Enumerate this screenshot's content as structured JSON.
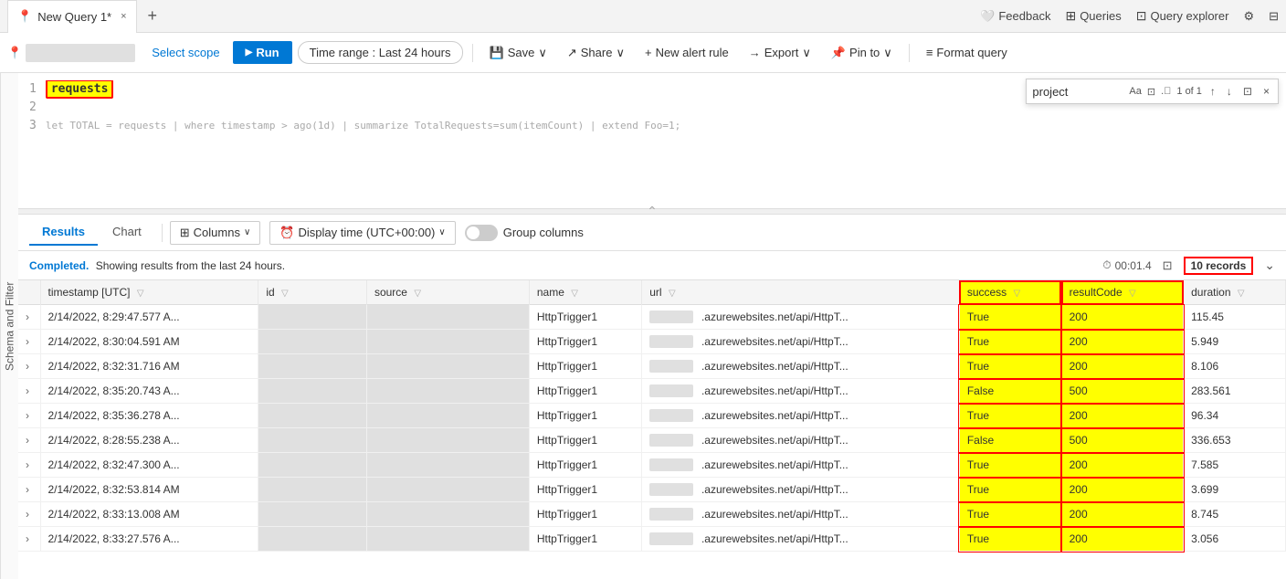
{
  "app": {
    "title": "New Query 1*",
    "tab_close": "×",
    "tab_add": "+",
    "top_actions": [
      {
        "id": "feedback",
        "icon": "❤",
        "label": "Feedback"
      },
      {
        "id": "queries",
        "icon": "⊞",
        "label": "Queries"
      },
      {
        "id": "query-explorer",
        "icon": "⊡",
        "label": "Query explorer"
      },
      {
        "id": "settings",
        "icon": "⚙",
        "label": ""
      },
      {
        "id": "layout",
        "icon": "⊟",
        "label": ""
      }
    ]
  },
  "toolbar": {
    "scope_placeholder": "",
    "select_scope": "Select scope",
    "run_label": "Run",
    "time_range_label": "Time range :  Last 24 hours",
    "save_label": "Save",
    "share_label": "Share",
    "new_alert_label": "New alert rule",
    "export_label": "Export",
    "pin_label": "Pin to",
    "format_label": "Format query"
  },
  "editor": {
    "search_placeholder": "project",
    "search_count": "1 of 1",
    "lines": [
      {
        "num": 1,
        "code": "requests",
        "highlight": true
      },
      {
        "num": 2,
        "code": ""
      },
      {
        "num": 3,
        "code": "let TOTAL = requests | where timestamp > ago(1d) | summarize TotalRequests=sum(itemCount) | extend Foo=1;",
        "dim": true
      }
    ]
  },
  "results_tabs": {
    "results_label": "Results",
    "chart_label": "Chart",
    "columns_label": "Columns",
    "display_time_label": "Display time (UTC+00:00)",
    "group_columns_label": "Group columns"
  },
  "status": {
    "message": "Completed.",
    "sub": "Showing results from the last 24 hours.",
    "time": "00:01.4",
    "records": "10 records"
  },
  "table": {
    "columns": [
      {
        "id": "expand",
        "label": ""
      },
      {
        "id": "timestamp",
        "label": "timestamp [UTC]"
      },
      {
        "id": "id",
        "label": "id"
      },
      {
        "id": "source",
        "label": "source"
      },
      {
        "id": "name",
        "label": "name"
      },
      {
        "id": "url",
        "label": "url"
      },
      {
        "id": "success",
        "label": "success"
      },
      {
        "id": "resultCode",
        "label": "resultCode"
      },
      {
        "id": "duration",
        "label": "duration"
      }
    ],
    "rows": [
      {
        "expand": ">",
        "timestamp": "2/14/2022, 8:29:47.577 A...",
        "id": "",
        "source": "",
        "name": "HttpTrigger1",
        "url": "https://  .azurewebsites.net/api/HttpT...",
        "success": "True",
        "resultCode": "200",
        "duration": "115.45"
      },
      {
        "expand": ">",
        "timestamp": "2/14/2022, 8:30:04.591 AM",
        "id": "",
        "source": "",
        "name": "HttpTrigger1",
        "url": "https://  .azurewebsites.net/api/HttpT...",
        "success": "True",
        "resultCode": "200",
        "duration": "5.949"
      },
      {
        "expand": ">",
        "timestamp": "2/14/2022, 8:32:31.716 AM",
        "id": "",
        "source": "",
        "name": "HttpTrigger1",
        "url": "https://  .azurewebsites.net/api/HttpT...",
        "success": "True",
        "resultCode": "200",
        "duration": "8.106"
      },
      {
        "expand": ">",
        "timestamp": "2/14/2022, 8:35:20.743 A...",
        "id": "",
        "source": "",
        "name": "HttpTrigger1",
        "url": "https://  .azurewebsites.net/api/HttpT...",
        "success": "False",
        "resultCode": "500",
        "duration": "283.561"
      },
      {
        "expand": ">",
        "timestamp": "2/14/2022, 8:35:36.278 A...",
        "id": "",
        "source": "",
        "name": "HttpTrigger1",
        "url": "https://  .azurewebsites.net/api/HttpT...",
        "success": "True",
        "resultCode": "200",
        "duration": "96.34"
      },
      {
        "expand": ">",
        "timestamp": "2/14/2022, 8:28:55.238 A...",
        "id": "",
        "source": "",
        "name": "HttpTrigger1",
        "url": "https://  .azurewebsites.net/api/HttpT...",
        "success": "False",
        "resultCode": "500",
        "duration": "336.653"
      },
      {
        "expand": ">",
        "timestamp": "2/14/2022, 8:32:47.300 A...",
        "id": "",
        "source": "",
        "name": "HttpTrigger1",
        "url": "https://  .azurewebsites.net/api/HttpT...",
        "success": "True",
        "resultCode": "200",
        "duration": "7.585"
      },
      {
        "expand": ">",
        "timestamp": "2/14/2022, 8:32:53.814 AM",
        "id": "",
        "source": "",
        "name": "HttpTrigger1",
        "url": "https://  .azurewebsites.net/api/HttpT...",
        "success": "True",
        "resultCode": "200",
        "duration": "3.699"
      },
      {
        "expand": ">",
        "timestamp": "2/14/2022, 8:33:13.008 AM",
        "id": "",
        "source": "",
        "name": "HttpTrigger1",
        "url": "https://  .azurewebsites.net/api/HttpT...",
        "success": "True",
        "resultCode": "200",
        "duration": "8.745"
      },
      {
        "expand": ">",
        "timestamp": "2/14/2022, 8:33:27.576 A...",
        "id": "",
        "source": "",
        "name": "HttpTrigger1",
        "url": "https://  .azurewebsites.net/api/HttpT...",
        "success": "True",
        "resultCode": "200",
        "duration": "3.056"
      }
    ]
  },
  "sidebar": {
    "label": "Schema and Filter"
  }
}
